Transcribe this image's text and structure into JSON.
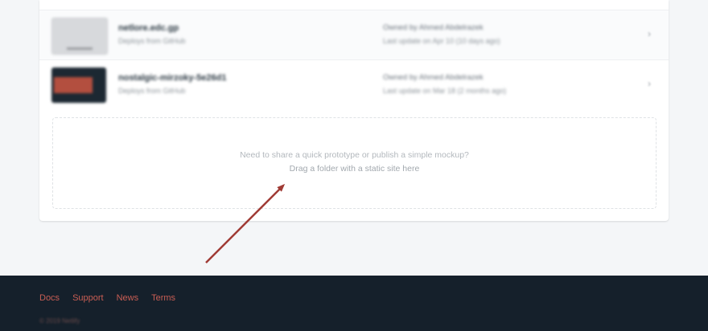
{
  "sites": [
    {
      "name": "netlore.edc.gp",
      "subtitle": "Deploys from GitHub",
      "owner": "Owned by Ahmed Abdelrazek",
      "updated": "Last update on Apr 10 (10 days ago)",
      "thumb_style": "light"
    },
    {
      "name": "nostalgic-mirzoky-5e26d1",
      "subtitle": "Deploys from GitHub",
      "owner": "Owned by Ahmed Abdelrazek",
      "updated": "Last update on Mar 18 (2 months ago)",
      "thumb_style": "dark"
    }
  ],
  "dropzone": {
    "line1": "Need to share a quick prototype or publish a simple mockup?",
    "line2": "Drag a folder with a static site here"
  },
  "footer": {
    "links": [
      "Docs",
      "Support",
      "News",
      "Terms"
    ],
    "copyright": "© 2019 Netlify"
  },
  "colors": {
    "arrow": "#a03b35",
    "footer_bg": "#15202b",
    "link": "#c95e54"
  },
  "icons": {
    "row_chevron": "chevron-right-icon"
  }
}
